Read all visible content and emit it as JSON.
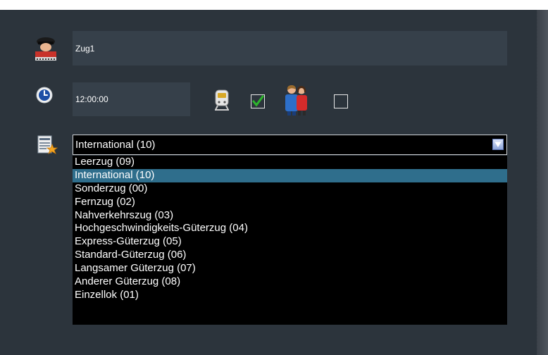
{
  "train": {
    "name_value": "Zug1",
    "time_value": "12:00:00",
    "first_checkbox_checked": true,
    "second_checkbox_checked": false
  },
  "category": {
    "selected": "International (10)",
    "options": [
      "Leerzug  (09)",
      "International (10)",
      "Sonderzug (00)",
      "Fernzug (02)",
      "Nahverkehrszug (03)",
      "Hochgeschwindigkeits-Güterzug (04)",
      "Express-Güterzug (05)",
      "Standard-Güterzug (06)",
      "Langsamer Güterzug (07)",
      "Anderer Güterzug (08)",
      "Einzellok (01)"
    ],
    "highlighted_index": 1
  },
  "icons": {
    "name_row": "train-driver-icon",
    "time_row": "clock-icon",
    "category_row": "category-settings-icon",
    "vehicle": "train-front-icon",
    "passengers": "passengers-icon",
    "dropdown": "dropdown-arrow-icon"
  },
  "colors": {
    "background": "#2c343c",
    "field_background": "#36404a",
    "list_background": "#000000",
    "highlight": "#2f6e8c",
    "check_green": "#2db52d"
  }
}
